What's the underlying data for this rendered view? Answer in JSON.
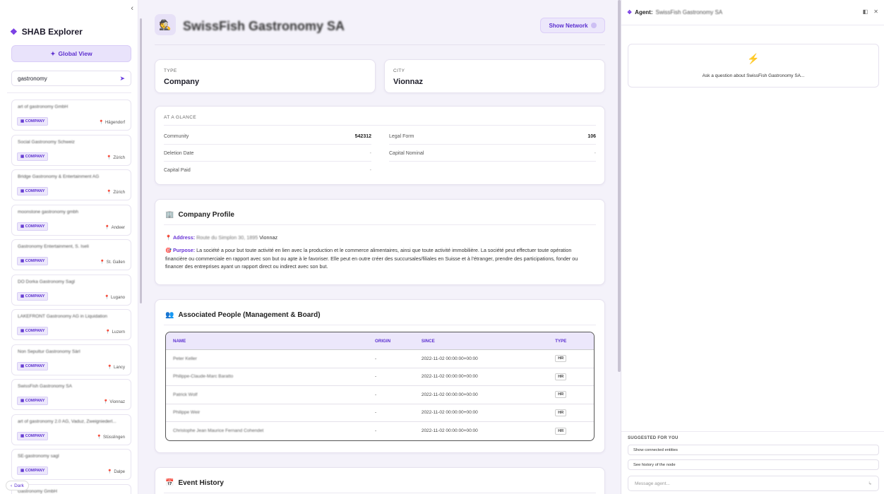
{
  "sidebar": {
    "collapse_glyph": "‹",
    "brand": "SHAB Explorer",
    "global_view_label": "Global View",
    "search_value": "gastronomy",
    "items": [
      {
        "name": "art of gastronomy GmbH",
        "badge": "COMPANY",
        "location": "Hägendorf"
      },
      {
        "name": "Social Gastronomy Schweiz",
        "badge": "COMPANY",
        "location": "Zürich"
      },
      {
        "name": "Bridge Gastronomy & Entertainment AG",
        "badge": "COMPANY",
        "location": "Zürich"
      },
      {
        "name": "moonstone gastronomy gmbh",
        "badge": "COMPANY",
        "location": "Andeer"
      },
      {
        "name": "Gastronomy Entertainment, S. Iseli",
        "badge": "COMPANY",
        "location": "St. Gallen"
      },
      {
        "name": "DO Dorka Gastronomy Sagl",
        "badge": "COMPANY",
        "location": "Lugano"
      },
      {
        "name": "LAKEFRONT Gastronomy AG in Liquidation",
        "badge": "COMPANY",
        "location": "Luzern"
      },
      {
        "name": "Non Sepultur Gastronomy Sàrl",
        "badge": "COMPANY",
        "location": "Lancy"
      },
      {
        "name": "SwissFish Gastronomy SA",
        "badge": "COMPANY",
        "location": "Vionnaz"
      },
      {
        "name": "art of gastronomy 2.0 AG, Vaduz, Zweigniederl...",
        "badge": "COMPANY",
        "location": "Stüsslingen"
      },
      {
        "name": "SE-gastronomy sagl",
        "badge": "COMPANY",
        "location": "Dalpe"
      },
      {
        "name": "Gastronomy GmbH",
        "badge": "COMPANY",
        "location": ""
      }
    ],
    "dark_label": "Dark"
  },
  "header": {
    "title": "SwissFish Gastronomy SA",
    "network_button": "Show Network"
  },
  "type_card": {
    "caption": "TYPE",
    "value": "Company"
  },
  "city_card": {
    "caption": "CITY",
    "value": "Vionnaz"
  },
  "glance": {
    "title": "AT A GLANCE",
    "community_label": "Community",
    "community_value": "542312",
    "legal_form_label": "Legal Form",
    "legal_form_value": "106",
    "deletion_label": "Deletion Date",
    "deletion_value": "-",
    "capital_nominal_label": "Capital Nominal",
    "capital_nominal_value": "-",
    "capital_paid_label": "Capital Paid",
    "capital_paid_value": "-"
  },
  "profile": {
    "title": "Company Profile",
    "address_label": "Address:",
    "address_street": "Route du Simplon 30, 1895",
    "address_city": "Vionnaz",
    "purpose_label": "Purpose:",
    "purpose_text": "La société a pour but toute activité en lien avec la production et le commerce alimentaires, ainsi que toute activité immobilière. La société peut effectuer toute opération financière ou commerciale en rapport avec son but ou apte à le favoriser. Elle peut en outre créer des succursales/filiales en Suisse et à l'étranger, prendre des participations, fonder ou financer des entreprises ayant un rapport direct ou indirect avec son but."
  },
  "people": {
    "title": "Associated People (Management & Board)",
    "headers": [
      "NAME",
      "ORIGIN",
      "SINCE",
      "TYPE"
    ],
    "rows": [
      {
        "name": "Peter Keller",
        "origin": "-",
        "since": "2022-11-02 00:00:00+00:00",
        "type": "HR"
      },
      {
        "name": "Philippe-Claude-Marc Baratto",
        "origin": "-",
        "since": "2022-11-02 00:00:00+00:00",
        "type": "HR"
      },
      {
        "name": "Patrick Wolf",
        "origin": "-",
        "since": "2022-11-02 00:00:00+00:00",
        "type": "HR"
      },
      {
        "name": "Philippe Weir",
        "origin": "-",
        "since": "2022-11-02 00:00:00+00:00",
        "type": "HR"
      },
      {
        "name": "Christophe Jean Maurice Fernand Cohendet",
        "origin": "-",
        "since": "2022-11-02 00:00:00+00:00",
        "type": "HR"
      }
    ]
  },
  "events": {
    "title": "Event History"
  },
  "agent": {
    "label": "Agent:",
    "subject": "SwissFish Gastronomy SA",
    "ask_text": "Ask a question about SwissFish Gastronomy SA...",
    "suggested_title": "SUGGESTED FOR YOU",
    "suggestions": [
      "Show connected entities",
      "See history of the node"
    ],
    "message_placeholder": "Message agent..."
  }
}
